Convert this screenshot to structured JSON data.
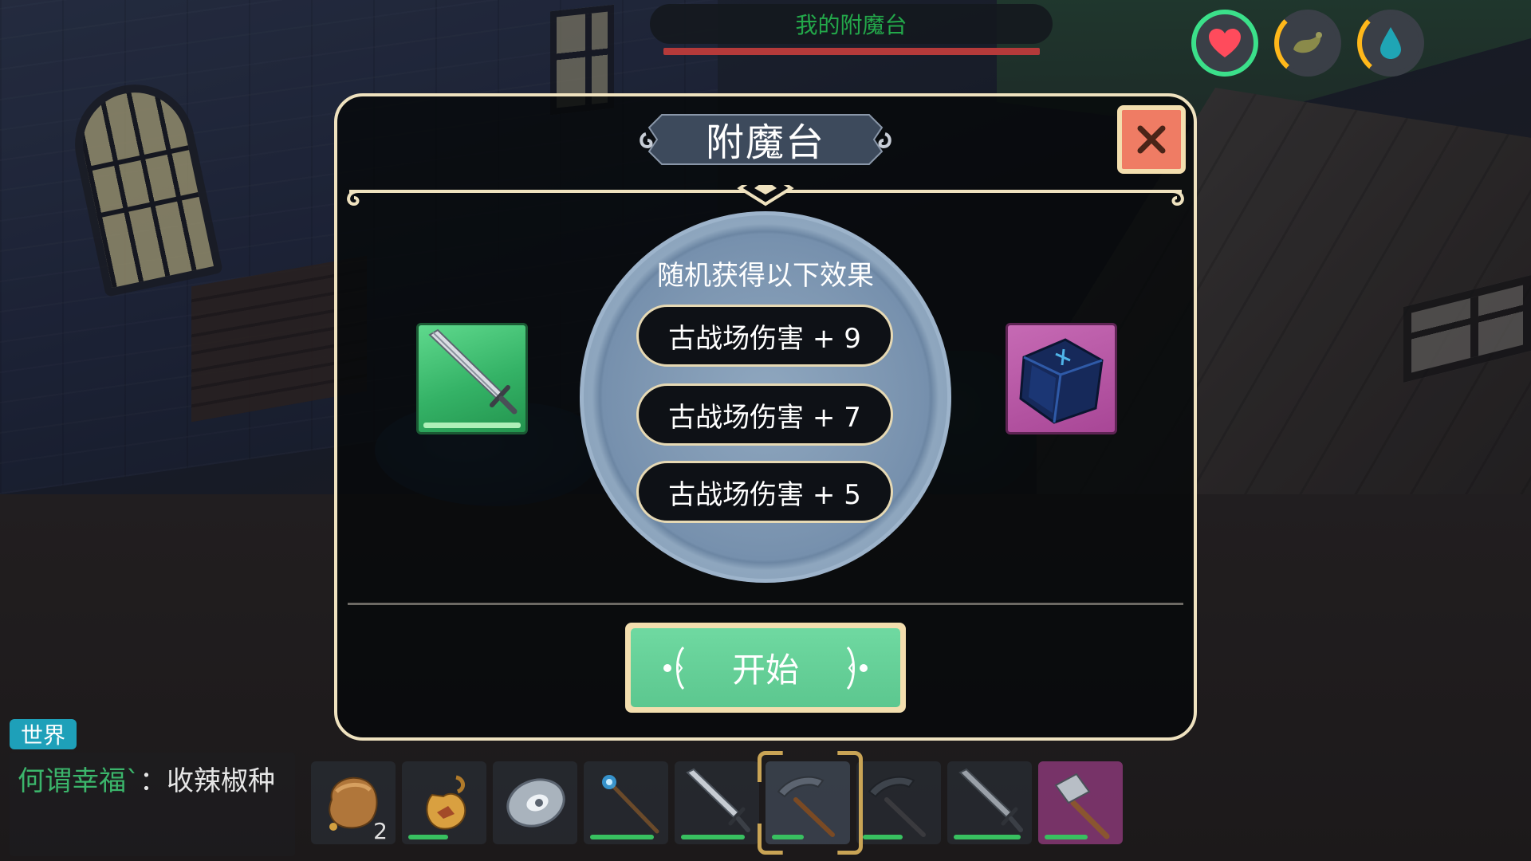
{
  "hud": {
    "title": "我的附魔台",
    "stats": [
      {
        "name": "health",
        "icon": "heart-icon",
        "color": "#3be08a"
      },
      {
        "name": "hunger",
        "icon": "food-icon",
        "color": "#ffb81a"
      },
      {
        "name": "water",
        "icon": "water-drop-icon",
        "color": "#ffb81a"
      }
    ]
  },
  "panel": {
    "title": "附魔台",
    "close_icon": "close-icon",
    "effects_heading": "随机获得以下效果",
    "effects": [
      "古战场伤害 + 9",
      "古战场伤害 + 7",
      "古战场伤害 + 5"
    ],
    "weapon_item": {
      "icon": "sword-icon",
      "bg_color": "#34b266"
    },
    "material_item": {
      "icon": "enchant-cube-icon",
      "bg_color": "#a84696"
    },
    "start_label": "开始",
    "start_color": "#5cc78f"
  },
  "chat": {
    "channel": "世界",
    "sender": "何谓幸福`",
    "separator": "：",
    "message": "收辣椒种"
  },
  "hotbar": {
    "selected_index": 5,
    "slots": [
      {
        "icon": "seed-bag-icon",
        "count": "2"
      },
      {
        "icon": "water-flask-icon",
        "durability": 0.55
      },
      {
        "icon": "stone-disc-icon"
      },
      {
        "icon": "magic-staff-icon",
        "durability": 0.8
      },
      {
        "icon": "sword-icon",
        "durability": 0.8
      },
      {
        "icon": "pickaxe-icon",
        "durability": 0.45
      },
      {
        "icon": "pickaxe-icon",
        "durability": 0.55
      },
      {
        "icon": "sword-icon",
        "durability": 0.85
      },
      {
        "icon": "hammer-icon",
        "durability": 0.6
      }
    ]
  }
}
